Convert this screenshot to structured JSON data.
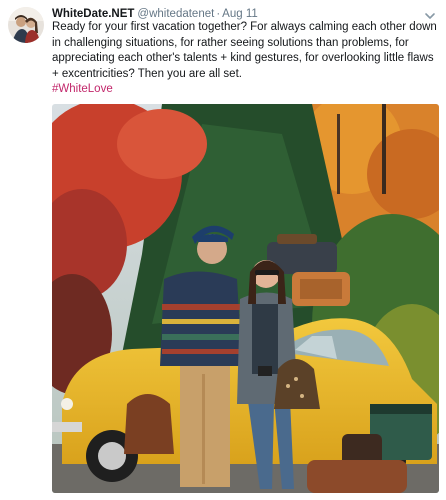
{
  "tweet": {
    "display_name": "WhiteDate.NET",
    "handle": "@whitedatenet",
    "separator": "·",
    "timestamp": "Aug 11",
    "text": "Ready for your first vacation together? For always calming each other down in challenging situations, for rather seeing solutions than problems, for appreciating each other's talents + kind gestures, for overlooking little flaws + excentricities? Then you are all set.",
    "hashtag": "#WhiteLove"
  },
  "icons": {
    "menu": "chevron-down-icon"
  },
  "colors": {
    "hashtag": "#c2276b",
    "meta_text": "#657786",
    "car": "#e9b52a",
    "foliage_red": "#c8402c"
  }
}
